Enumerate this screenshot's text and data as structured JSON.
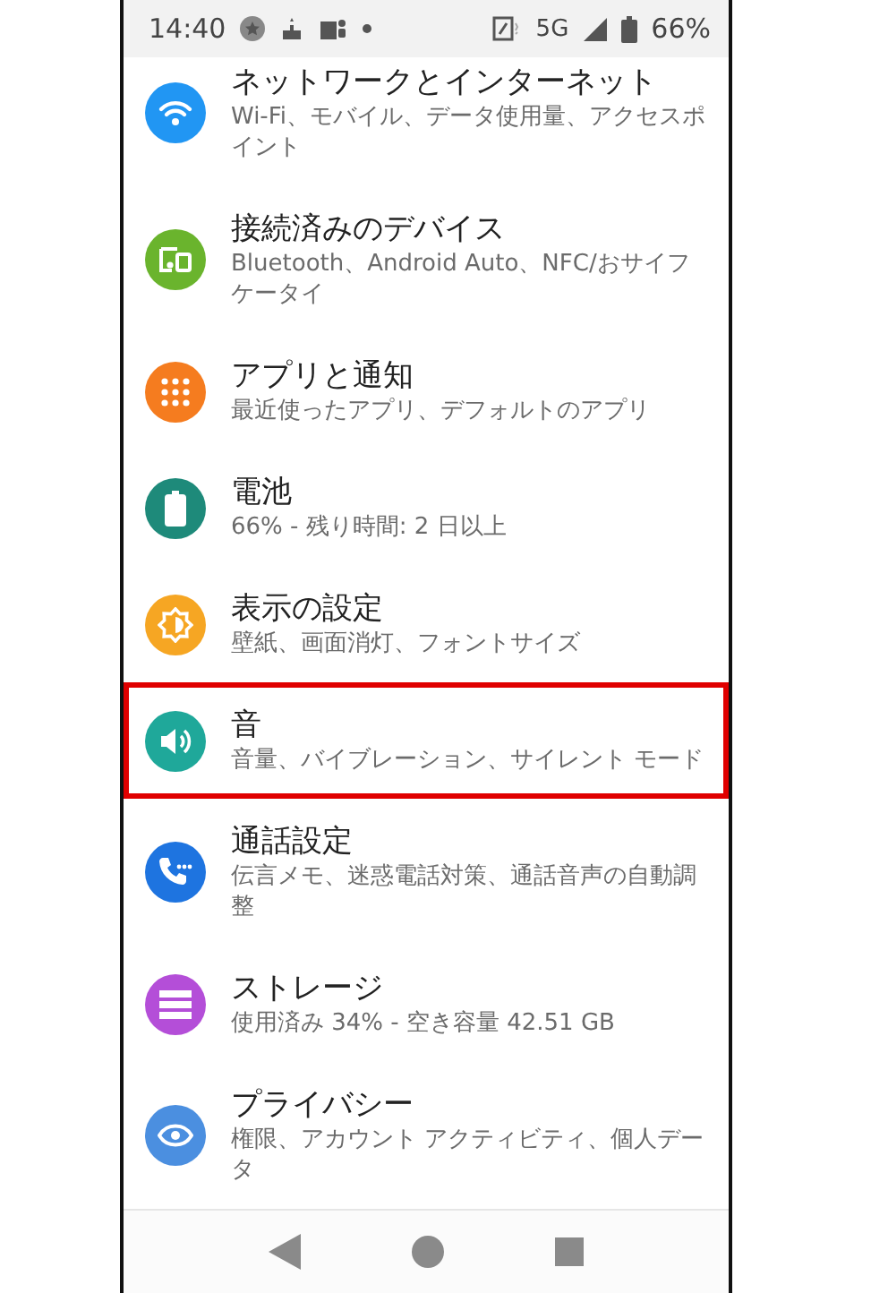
{
  "status_bar": {
    "time": "14:40",
    "network": "5G",
    "battery": "66%"
  },
  "items": [
    {
      "title": "ネットワークとインターネット",
      "subtitle": "Wi-Fi、モバイル、データ使用量、アクセスポイント",
      "color": "#2196f3",
      "selected": false
    },
    {
      "title": "接続済みのデバイス",
      "subtitle": "Bluetooth、Android Auto、NFC/おサイフケータイ",
      "color": "#6ab42d",
      "selected": false
    },
    {
      "title": "アプリと通知",
      "subtitle": "最近使ったアプリ、デフォルトのアプリ",
      "color": "#f57c1f",
      "selected": false
    },
    {
      "title": "電池",
      "subtitle": "66% - 残り時間: 2 日以上",
      "color": "#1e8a7a",
      "selected": false
    },
    {
      "title": "表示の設定",
      "subtitle": "壁紙、画面消灯、フォントサイズ",
      "color": "#f6a623",
      "selected": false
    },
    {
      "title": "音",
      "subtitle": "音量、バイブレーション、サイレント モード",
      "color": "#1fa89a",
      "selected": true
    },
    {
      "title": "通話設定",
      "subtitle": "伝言メモ、迷惑電話対策、通話音声の自動調整",
      "color": "#1e74e0",
      "selected": false
    },
    {
      "title": "ストレージ",
      "subtitle": "使用済み 34% - 空き容量 42.51 GB",
      "color": "#b44ed8",
      "selected": false
    },
    {
      "title": "プライバシー",
      "subtitle": "権限、アカウント アクティビティ、個人データ",
      "color": "#4b8fe0",
      "selected": false
    }
  ]
}
